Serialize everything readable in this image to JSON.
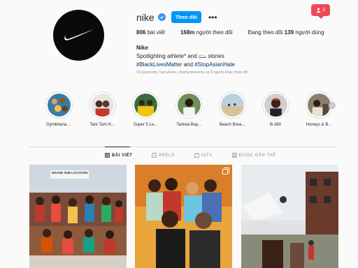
{
  "profile": {
    "username": "nike",
    "follow_label": "Theo dõi",
    "more_label": "•••",
    "notification_count": "3",
    "stats": {
      "posts_count": "806",
      "posts_label": "bài viết",
      "followers_count": "168m",
      "followers_label": "người theo dõi",
      "following_prefix": "Đang theo dõi",
      "following_count": "139",
      "following_suffix": "người dùng"
    },
    "full_name": "Nike",
    "bio_line1_a": "Spotlighting athlete* and",
    "bio_line1_b": "stories",
    "bio_tag1": "#BlackLivesMatter",
    "bio_and": "and",
    "bio_tag2": "#StopAsianHate",
    "followed_by": "Có jayshetty, harrykane, charlyclements và 9 người khác theo dõi"
  },
  "highlights": [
    {
      "label": "Gymkhana ..."
    },
    {
      "label": "Tam Tam H..."
    },
    {
      "label": "Super 5 Le..."
    },
    {
      "label": "Tarkwa Bay..."
    },
    {
      "label": "Beach Brea..."
    },
    {
      "label": "B-360"
    },
    {
      "label": "Honeys & B..."
    }
  ],
  "tabs": {
    "posts": "BÀI VIẾT",
    "reels": "REELS",
    "igtv": "IGTV",
    "tagged": "ĐƯỢC GẮN THẺ"
  },
  "post1_sign": "GRAND SUB LOCATION",
  "colors": {
    "accent": "#0095f6",
    "verified": "#3897f0",
    "notification": "#ed4956"
  }
}
